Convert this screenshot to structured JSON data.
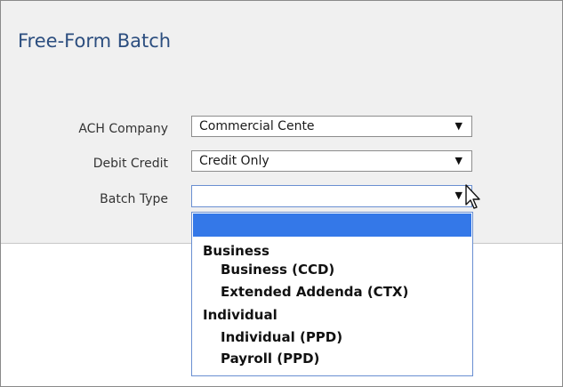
{
  "page": {
    "title": "Free-Form Batch"
  },
  "form": {
    "ach_company": {
      "label": "ACH Company",
      "value": "Commercial Cente"
    },
    "debit_credit": {
      "label": "Debit Credit",
      "value": "Credit Only"
    },
    "batch_type": {
      "label": "Batch Type",
      "value": ""
    }
  },
  "dropdown": {
    "groups": [
      {
        "label": "Business",
        "items": [
          "Business (CCD)",
          "Extended Addenda (CTX)"
        ]
      },
      {
        "label": "Individual",
        "items": [
          "Individual (PPD)",
          "Payroll (PPD)"
        ]
      }
    ],
    "highlight_color": "#3478e8"
  },
  "icons": {
    "arrow": "dropdown-arrow-icon",
    "cursor": "mouse-pointer-icon"
  }
}
